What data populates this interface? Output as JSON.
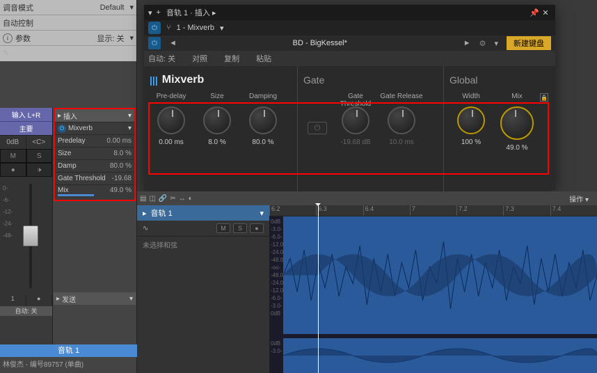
{
  "left": {
    "tuning_mode": "调音模式",
    "tuning_val": "Default",
    "automation": "自动控制",
    "params": "参数",
    "display": "显示: 关"
  },
  "mixer": {
    "input": "输入 L+R",
    "main": "主要",
    "db": "0dB",
    "c": "<C>",
    "m": "M",
    "s": "S",
    "scale": [
      "0-",
      "-6-",
      "-12-",
      "-24-",
      "-48-"
    ],
    "one": "1",
    "vol_dot": "●",
    "auto": "自动: 关"
  },
  "inserts": {
    "header": "插入",
    "plugin_name": "Mixverb",
    "rows": [
      {
        "name": "Predelay",
        "val": "0.00 ms"
      },
      {
        "name": "Size",
        "val": "8.0 %"
      },
      {
        "name": "Damp",
        "val": "80.0 %"
      },
      {
        "name": "Gate Threshold",
        "val": "-19.68"
      },
      {
        "name": "Mix",
        "val": "49.0 %"
      }
    ]
  },
  "sends": {
    "header": "发送"
  },
  "track_bar": "音轨 1",
  "track_sub": "林俊杰 - 编号89757 (单曲)",
  "plugin": {
    "title": "音轨 1 · 插入 ▸",
    "dropdown": "1 - Mixverb",
    "preset": "BD - BigKessel*",
    "auto_off": "自动: 关",
    "compare": "对照",
    "copy": "复制",
    "paste": "粘贴",
    "newkey": "新建键盘",
    "brand": "Mixverb",
    "sections": {
      "main": "",
      "gate": "Gate",
      "global": "Global"
    },
    "knobs": {
      "predelay": {
        "label": "Pre-delay",
        "value": "0.00 ms",
        "angle": -135
      },
      "size": {
        "label": "Size",
        "value": "8.0 %",
        "angle": -120
      },
      "damping": {
        "label": "Damping",
        "value": "80.0 %",
        "angle": 90
      },
      "gate_threshold": {
        "label": "Gate Threshold",
        "value": "-19.68 dB",
        "angle": 30
      },
      "gate_release": {
        "label": "Gate Release",
        "value": "10.0 ms",
        "angle": -135
      },
      "width": {
        "label": "Width",
        "value": "100 %",
        "angle": 135
      },
      "mix": {
        "label": "Mix",
        "value": "49.0 %",
        "angle": -5
      }
    }
  },
  "arrange": {
    "ops": "操作 ▾",
    "track_name": "音轨 1",
    "m": "M",
    "s": "S",
    "chord": "未选择和弦",
    "ruler": [
      "6.2",
      "6.3",
      "6.4",
      "7",
      "7.2",
      "7.3",
      "7.4"
    ],
    "db_scale": [
      "0dB",
      "-3.0-",
      "-6.0-",
      "-12.0-",
      "-24.0-",
      "-48.0-",
      "-oo-",
      "-48.0-",
      "-24.0-",
      "-12.0-",
      "-6.0-",
      "-3.0-",
      "0dB",
      "0dB",
      "-3.0-"
    ]
  }
}
